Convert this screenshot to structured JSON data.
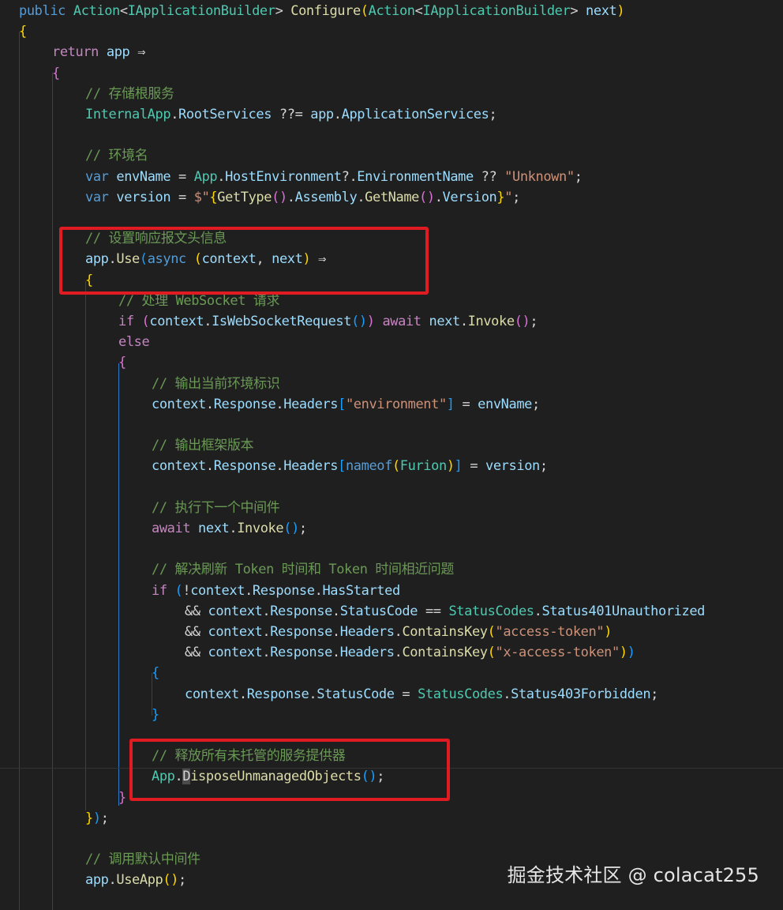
{
  "editor": {
    "language": "csharp",
    "theme": "dark",
    "lines": [
      {
        "tokens": [
          [
            "kw",
            "public"
          ],
          [
            "op",
            " "
          ],
          [
            "type",
            "Action"
          ],
          [
            "op",
            "<"
          ],
          [
            "type",
            "IApplicationBuilder"
          ],
          [
            "op",
            "> "
          ],
          [
            "fn",
            "Configure"
          ],
          [
            "b1",
            "("
          ],
          [
            "type",
            "Action"
          ],
          [
            "op",
            "<"
          ],
          [
            "type",
            "IApplicationBuilder"
          ],
          [
            "op",
            "> "
          ],
          [
            "var",
            "next"
          ],
          [
            "b1",
            ")"
          ]
        ]
      },
      {
        "tokens": [
          [
            "b1",
            "{"
          ]
        ]
      },
      {
        "tokens": [
          [
            "kw2",
            "return"
          ],
          [
            "op",
            " "
          ],
          [
            "var",
            "app"
          ],
          [
            "op",
            " ⇒"
          ]
        ]
      },
      {
        "tokens": [
          [
            "b2",
            "{"
          ]
        ]
      },
      {
        "tokens": [
          [
            "cm",
            "// 存储根服务"
          ]
        ]
      },
      {
        "tokens": [
          [
            "type",
            "InternalApp"
          ],
          [
            "op",
            "."
          ],
          [
            "var",
            "RootServices"
          ],
          [
            "op",
            " ??= "
          ],
          [
            "var",
            "app"
          ],
          [
            "op",
            "."
          ],
          [
            "var",
            "ApplicationServices"
          ],
          [
            "op",
            ";"
          ]
        ]
      },
      {
        "tokens": []
      },
      {
        "tokens": [
          [
            "cm",
            "// 环境名"
          ]
        ]
      },
      {
        "tokens": [
          [
            "kw",
            "var"
          ],
          [
            "op",
            " "
          ],
          [
            "var",
            "envName"
          ],
          [
            "op",
            " = "
          ],
          [
            "type",
            "App"
          ],
          [
            "op",
            "."
          ],
          [
            "var",
            "HostEnvironment"
          ],
          [
            "op",
            "?."
          ],
          [
            "var",
            "EnvironmentName"
          ],
          [
            "op",
            " ?? "
          ],
          [
            "str",
            "\"Unknown\""
          ],
          [
            "op",
            ";"
          ]
        ]
      },
      {
        "tokens": [
          [
            "kw",
            "var"
          ],
          [
            "op",
            " "
          ],
          [
            "var",
            "version"
          ],
          [
            "op",
            " = "
          ],
          [
            "str",
            "$\""
          ],
          [
            "b1",
            "{"
          ],
          [
            "fn",
            "GetType"
          ],
          [
            "b2",
            "()"
          ],
          [
            "op",
            "."
          ],
          [
            "var",
            "Assembly"
          ],
          [
            "op",
            "."
          ],
          [
            "fn",
            "GetName"
          ],
          [
            "b2",
            "()"
          ],
          [
            "op",
            "."
          ],
          [
            "var",
            "Version"
          ],
          [
            "b1",
            "}"
          ],
          [
            "str",
            "\""
          ],
          [
            "op",
            ";"
          ]
        ]
      },
      {
        "tokens": []
      },
      {
        "tokens": [
          [
            "cm",
            "// 设置响应报文头信息"
          ]
        ]
      },
      {
        "tokens": [
          [
            "var",
            "app"
          ],
          [
            "op",
            "."
          ],
          [
            "fn",
            "Use"
          ],
          [
            "b3",
            "("
          ],
          [
            "kw",
            "async"
          ],
          [
            "op",
            " "
          ],
          [
            "b1",
            "("
          ],
          [
            "var",
            "context"
          ],
          [
            "op",
            ", "
          ],
          [
            "var",
            "next"
          ],
          [
            "b1",
            ")"
          ],
          [
            "op",
            " ⇒"
          ]
        ]
      },
      {
        "tokens": [
          [
            "b1",
            "{"
          ]
        ]
      },
      {
        "tokens": [
          [
            "cm",
            "// 处理 WebSocket 请求"
          ]
        ]
      },
      {
        "tokens": [
          [
            "kw2",
            "if"
          ],
          [
            "op",
            " "
          ],
          [
            "b2",
            "("
          ],
          [
            "var",
            "context"
          ],
          [
            "op",
            "."
          ],
          [
            "var",
            "IsWebSocketRequest"
          ],
          [
            "b3",
            "()"
          ],
          [
            "b2",
            ")"
          ],
          [
            "op",
            " "
          ],
          [
            "kw2",
            "await"
          ],
          [
            "op",
            " "
          ],
          [
            "var",
            "next"
          ],
          [
            "op",
            "."
          ],
          [
            "fn",
            "Invoke"
          ],
          [
            "b2",
            "()"
          ],
          [
            "op",
            ";"
          ]
        ]
      },
      {
        "tokens": [
          [
            "kw2",
            "else"
          ]
        ]
      },
      {
        "tokens": [
          [
            "b2",
            "{"
          ]
        ]
      },
      {
        "tokens": [
          [
            "cm",
            "// 输出当前环境标识"
          ]
        ]
      },
      {
        "tokens": [
          [
            "var",
            "context"
          ],
          [
            "op",
            "."
          ],
          [
            "var",
            "Response"
          ],
          [
            "op",
            "."
          ],
          [
            "var",
            "Headers"
          ],
          [
            "b3",
            "["
          ],
          [
            "str",
            "\"environment\""
          ],
          [
            "b3",
            "]"
          ],
          [
            "op",
            " = "
          ],
          [
            "var",
            "envName"
          ],
          [
            "op",
            ";"
          ]
        ]
      },
      {
        "tokens": []
      },
      {
        "tokens": [
          [
            "cm",
            "// 输出框架版本"
          ]
        ]
      },
      {
        "tokens": [
          [
            "var",
            "context"
          ],
          [
            "op",
            "."
          ],
          [
            "var",
            "Response"
          ],
          [
            "op",
            "."
          ],
          [
            "var",
            "Headers"
          ],
          [
            "b3",
            "["
          ],
          [
            "kw",
            "nameof"
          ],
          [
            "b1",
            "("
          ],
          [
            "type",
            "Furion"
          ],
          [
            "b1",
            ")"
          ],
          [
            "b3",
            "]"
          ],
          [
            "op",
            " = "
          ],
          [
            "var",
            "version"
          ],
          [
            "op",
            ";"
          ]
        ]
      },
      {
        "tokens": []
      },
      {
        "tokens": [
          [
            "cm",
            "// 执行下一个中间件"
          ]
        ]
      },
      {
        "tokens": [
          [
            "kw2",
            "await"
          ],
          [
            "op",
            " "
          ],
          [
            "var",
            "next"
          ],
          [
            "op",
            "."
          ],
          [
            "fn",
            "Invoke"
          ],
          [
            "b3",
            "()"
          ],
          [
            "op",
            ";"
          ]
        ]
      },
      {
        "tokens": []
      },
      {
        "tokens": [
          [
            "cm",
            "// 解决刷新 Token 时间和 Token 时间相近问题"
          ]
        ]
      },
      {
        "tokens": [
          [
            "kw2",
            "if"
          ],
          [
            "op",
            " "
          ],
          [
            "b3",
            "("
          ],
          [
            "op",
            "!"
          ],
          [
            "var",
            "context"
          ],
          [
            "op",
            "."
          ],
          [
            "var",
            "Response"
          ],
          [
            "op",
            "."
          ],
          [
            "var",
            "HasStarted"
          ]
        ]
      },
      {
        "tokens": [
          [
            "op",
            "&& "
          ],
          [
            "var",
            "context"
          ],
          [
            "op",
            "."
          ],
          [
            "var",
            "Response"
          ],
          [
            "op",
            "."
          ],
          [
            "var",
            "StatusCode"
          ],
          [
            "op",
            " == "
          ],
          [
            "type",
            "StatusCodes"
          ],
          [
            "op",
            "."
          ],
          [
            "var",
            "Status401Unauthorized"
          ]
        ]
      },
      {
        "tokens": [
          [
            "op",
            "&& "
          ],
          [
            "var",
            "context"
          ],
          [
            "op",
            "."
          ],
          [
            "var",
            "Response"
          ],
          [
            "op",
            "."
          ],
          [
            "var",
            "Headers"
          ],
          [
            "op",
            "."
          ],
          [
            "fn",
            "ContainsKey"
          ],
          [
            "b1",
            "("
          ],
          [
            "str",
            "\"access-token\""
          ],
          [
            "b1",
            ")"
          ]
        ]
      },
      {
        "tokens": [
          [
            "op",
            "&& "
          ],
          [
            "var",
            "context"
          ],
          [
            "op",
            "."
          ],
          [
            "var",
            "Response"
          ],
          [
            "op",
            "."
          ],
          [
            "var",
            "Headers"
          ],
          [
            "op",
            "."
          ],
          [
            "fn",
            "ContainsKey"
          ],
          [
            "b1",
            "("
          ],
          [
            "str",
            "\"x-access-token\""
          ],
          [
            "b1",
            ")"
          ],
          [
            "b3",
            ")"
          ]
        ]
      },
      {
        "tokens": [
          [
            "b3",
            "{"
          ]
        ]
      },
      {
        "tokens": [
          [
            "var",
            "context"
          ],
          [
            "op",
            "."
          ],
          [
            "var",
            "Response"
          ],
          [
            "op",
            "."
          ],
          [
            "var",
            "StatusCode"
          ],
          [
            "op",
            " = "
          ],
          [
            "type",
            "StatusCodes"
          ],
          [
            "op",
            "."
          ],
          [
            "var",
            "Status403Forbidden"
          ],
          [
            "op",
            ";"
          ]
        ]
      },
      {
        "tokens": [
          [
            "b3",
            "}"
          ]
        ]
      },
      {
        "tokens": []
      },
      {
        "tokens": [
          [
            "cm",
            "// 释放所有未托管的服务提供器"
          ]
        ]
      },
      {
        "tokens": [
          [
            "type",
            "App"
          ],
          [
            "op",
            "."
          ],
          [
            "hl",
            "D"
          ],
          [
            "fn",
            "isposeUnmanagedObjects"
          ],
          [
            "b3",
            "()"
          ],
          [
            "op",
            ";"
          ]
        ]
      },
      {
        "tokens": [
          [
            "b2",
            "}"
          ]
        ]
      },
      {
        "tokens": [
          [
            "b1",
            "}"
          ],
          [
            "b3",
            ")"
          ],
          [
            "op",
            ";"
          ]
        ]
      },
      {
        "tokens": []
      },
      {
        "tokens": [
          [
            "cm",
            "// 调用默认中间件"
          ]
        ]
      },
      {
        "tokens": [
          [
            "var",
            "app"
          ],
          [
            "op",
            "."
          ],
          [
            "fn",
            "UseApp"
          ],
          [
            "b1",
            "()"
          ],
          [
            "op",
            ";"
          ]
        ]
      },
      {
        "tokens": []
      }
    ]
  },
  "watermark": {
    "text": "掘金技术社区 @ colacat255"
  }
}
